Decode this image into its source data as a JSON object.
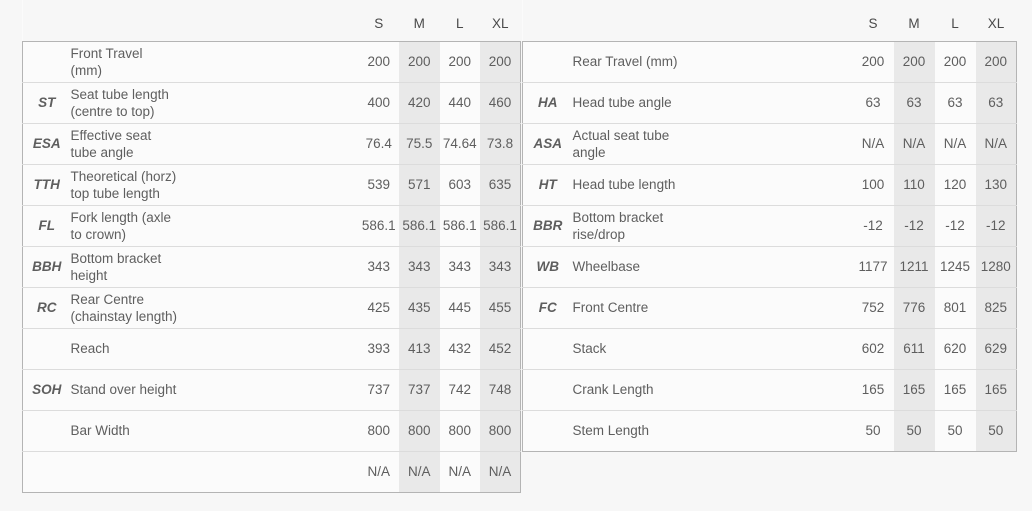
{
  "page": {
    "background": "#f7f7f7",
    "shaded_column_color": "#e9e9e9",
    "plain_column_color": "#fbfbfb",
    "border_color": "#b4b4b4"
  },
  "tables": [
    {
      "id": "left",
      "size_headers": [
        "S",
        "M",
        "L",
        "XL"
      ],
      "rows": [
        {
          "abbr": "",
          "desc": [
            "Front Travel",
            "(mm)"
          ],
          "values": [
            "200",
            "200",
            "200",
            "200"
          ]
        },
        {
          "abbr": "ST",
          "desc": [
            "Seat tube length",
            "(centre to top)"
          ],
          "values": [
            "400",
            "420",
            "440",
            "460"
          ]
        },
        {
          "abbr": "ESA",
          "desc": [
            "Effective seat",
            "tube angle"
          ],
          "values": [
            "76.4",
            "75.5",
            "74.64",
            "73.8"
          ]
        },
        {
          "abbr": "TTH",
          "desc": [
            "Theoretical (horz)",
            "top tube length"
          ],
          "values": [
            "539",
            "571",
            "603",
            "635"
          ]
        },
        {
          "abbr": "FL",
          "desc": [
            "Fork length (axle",
            "to crown)"
          ],
          "values": [
            "586.1",
            "586.1",
            "586.1",
            "586.1"
          ]
        },
        {
          "abbr": "BBH",
          "desc": [
            "Bottom bracket",
            "height"
          ],
          "values": [
            "343",
            "343",
            "343",
            "343"
          ]
        },
        {
          "abbr": "RC",
          "desc": [
            "Rear Centre",
            "(chainstay length)"
          ],
          "values": [
            "425",
            "435",
            "445",
            "455"
          ]
        },
        {
          "abbr": "",
          "desc": [
            "Reach"
          ],
          "values": [
            "393",
            "413",
            "432",
            "452"
          ]
        },
        {
          "abbr": "SOH",
          "desc": [
            "Stand over height"
          ],
          "values": [
            "737",
            "737",
            "742",
            "748"
          ]
        },
        {
          "abbr": "",
          "desc": [
            "Bar Width"
          ],
          "values": [
            "800",
            "800",
            "800",
            "800"
          ]
        },
        {
          "abbr": "",
          "desc": [
            ""
          ],
          "values": [
            "N/A",
            "N/A",
            "N/A",
            "N/A"
          ]
        }
      ]
    },
    {
      "id": "right",
      "size_headers": [
        "S",
        "M",
        "L",
        "XL"
      ],
      "rows": [
        {
          "abbr": "",
          "desc": [
            "Rear Travel (mm)"
          ],
          "values": [
            "200",
            "200",
            "200",
            "200"
          ]
        },
        {
          "abbr": "HA",
          "desc": [
            "Head tube angle"
          ],
          "values": [
            "63",
            "63",
            "63",
            "63"
          ]
        },
        {
          "abbr": "ASA",
          "desc": [
            "Actual seat tube",
            "angle"
          ],
          "values": [
            "N/A",
            "N/A",
            "N/A",
            "N/A"
          ]
        },
        {
          "abbr": "HT",
          "desc": [
            "Head tube length"
          ],
          "values": [
            "100",
            "110",
            "120",
            "130"
          ]
        },
        {
          "abbr": "BBR",
          "desc": [
            "Bottom bracket",
            "rise/drop"
          ],
          "values": [
            "-12",
            "-12",
            "-12",
            "-12"
          ]
        },
        {
          "abbr": "WB",
          "desc": [
            "Wheelbase"
          ],
          "values": [
            "1177",
            "1211",
            "1245",
            "1280"
          ]
        },
        {
          "abbr": "FC",
          "desc": [
            "Front Centre"
          ],
          "values": [
            "752",
            "776",
            "801",
            "825"
          ]
        },
        {
          "abbr": "",
          "desc": [
            "Stack"
          ],
          "values": [
            "602",
            "611",
            "620",
            "629"
          ]
        },
        {
          "abbr": "",
          "desc": [
            "Crank Length"
          ],
          "values": [
            "165",
            "165",
            "165",
            "165"
          ]
        },
        {
          "abbr": "",
          "desc": [
            "Stem Length"
          ],
          "values": [
            "50",
            "50",
            "50",
            "50"
          ]
        }
      ]
    }
  ]
}
